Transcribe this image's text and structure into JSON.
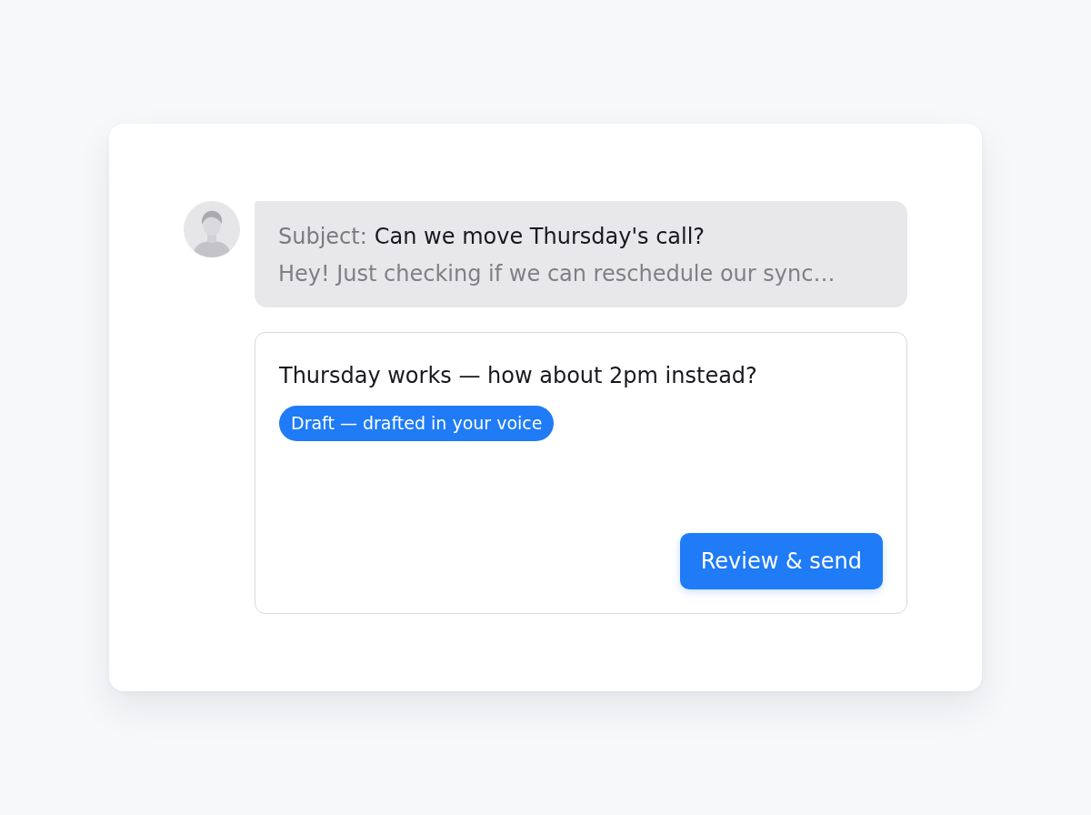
{
  "message": {
    "subject_label": "Subject:",
    "subject": "Can we move Thursday's call?",
    "preview": "Hey! Just checking if we can reschedule our sync…"
  },
  "reply": {
    "text": "Thursday works — how about 2pm instead?",
    "badge": "Draft — drafted in your voice",
    "button": "Review & send"
  }
}
